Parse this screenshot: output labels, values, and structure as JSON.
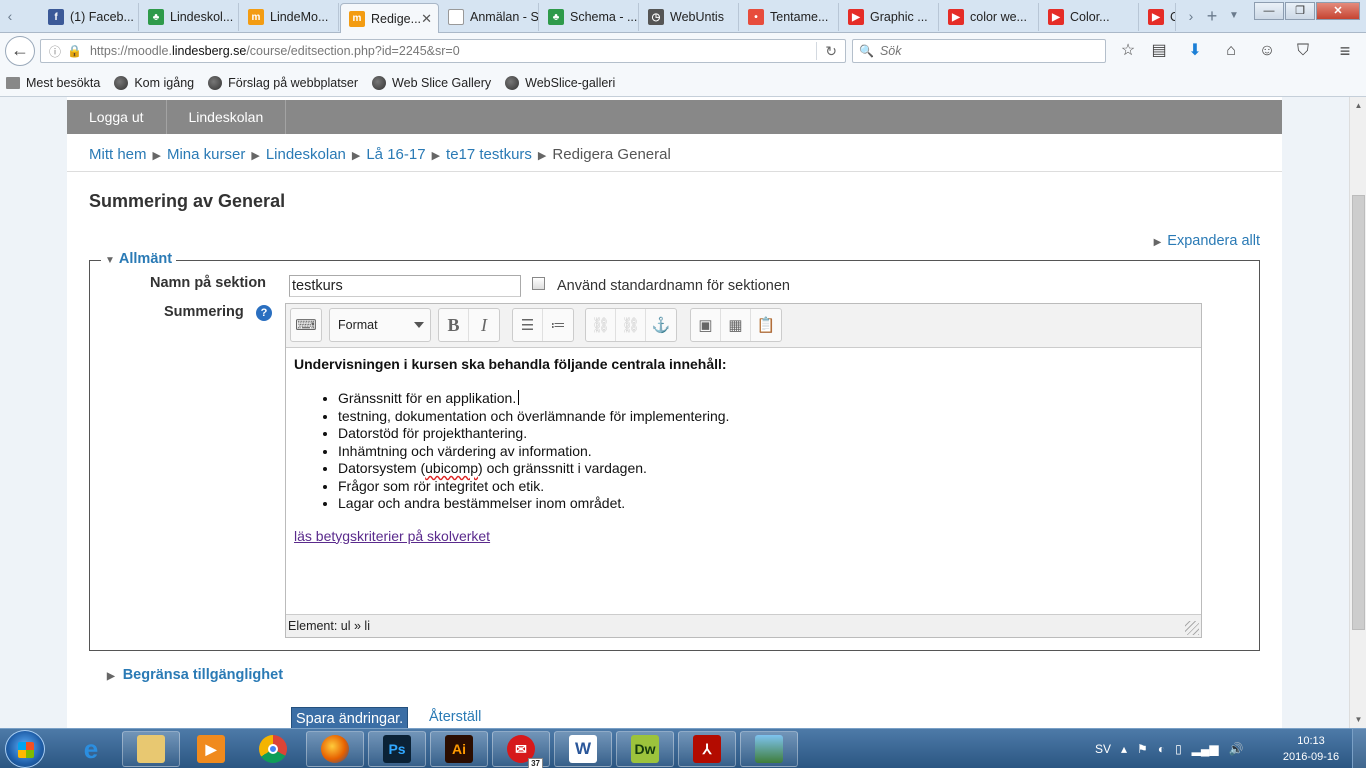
{
  "browser": {
    "tabs": [
      {
        "title": "(1) Faceb...",
        "icon": "facebook-icon",
        "color": "#3b5998",
        "glyph": "f"
      },
      {
        "title": "Lindeskol...",
        "icon": "moodle-icon",
        "color": "#2e9a4a",
        "glyph": "♣"
      },
      {
        "title": "LindeMo...",
        "icon": "moodle-hat-icon",
        "color": "#f39c12",
        "glyph": "m"
      },
      {
        "title": "Redige...",
        "icon": "moodle-hat-icon",
        "color": "#f39c12",
        "glyph": "m",
        "active": true
      },
      {
        "title": "Anmälan - Sit...",
        "icon": "blank-page-icon",
        "color": "#ffffff",
        "glyph": ""
      },
      {
        "title": "Schema - ...",
        "icon": "moodle-icon",
        "color": "#2e9a4a",
        "glyph": "♣"
      },
      {
        "title": "WebUntis",
        "icon": "clock-icon",
        "color": "#555555",
        "glyph": "◷"
      },
      {
        "title": "Tentame...",
        "icon": "dots-icon",
        "color": "#e74c3c",
        "glyph": "•"
      },
      {
        "title": "Graphic ...",
        "icon": "youtube-icon",
        "color": "#e52d27",
        "glyph": "▶"
      },
      {
        "title": "color we...",
        "icon": "youtube-icon",
        "color": "#e52d27",
        "glyph": "▶"
      },
      {
        "title": "Color...",
        "icon": "youtube-icon",
        "color": "#e52d27",
        "glyph": "▶"
      },
      {
        "title": "Co",
        "icon": "youtube-icon",
        "color": "#e52d27",
        "glyph": "▶"
      }
    ],
    "url_prefix": "https://moodle.",
    "url_domain": "lindesberg.se",
    "url_path": "/course/editsection.php?id=2245&sr=0",
    "search_placeholder": "Sök",
    "bookmarks": [
      "Mest besökta",
      "Kom igång",
      "Förslag på webbplatser",
      "Web Slice Gallery",
      "WebSlice-galleri"
    ]
  },
  "nav": {
    "logout": "Logga ut",
    "school": "Lindeskolan"
  },
  "breadcrumb": {
    "items": [
      "Mitt hem",
      "Mina kurser",
      "Lindeskolan",
      "Lå 16-17",
      "te17 testkurs"
    ],
    "current": "Redigera General"
  },
  "page": {
    "title": "Summering av General",
    "expand_all": "Expandera allt",
    "section_legend": "Allmänt",
    "name_label": "Namn på sektion",
    "name_value": "testkurs",
    "default_name_label": "Använd standardnamn för sektionen",
    "summary_label": "Summering",
    "restrict": "Begränsa tillgänglighet",
    "save": "Spara ändringar.",
    "reset": "Återställ"
  },
  "editor": {
    "format_label": "Format",
    "intro": "Undervisningen i kursen ska behandla följande centrala innehåll:",
    "items": [
      "Gränssnitt för en applikation.",
      "testning, dokumentation och överlämnande för implementering.",
      "Datorstöd för projekthantering.",
      "Inhämtning och värdering av information.",
      "Datorsystem (",
      "Frågor som rör integritet och etik.",
      "Lagar och andra bestämmelser inom området."
    ],
    "item5_spell": "ubicomp",
    "item5_rest": ") och gränssnitt i vardagen.",
    "link": "läs betygskriterier på skolverket",
    "status": "Element: ul » li"
  },
  "taskbar": {
    "lang": "SV",
    "time": "10:13",
    "date": "2016-09-16",
    "badge": "37"
  }
}
